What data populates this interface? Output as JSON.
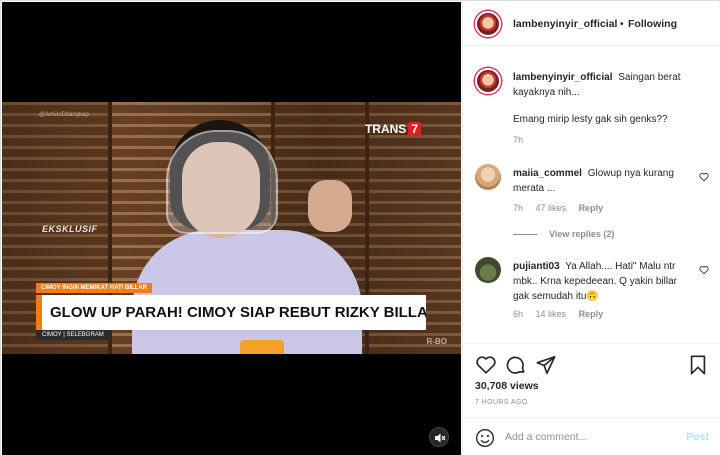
{
  "video": {
    "watermark": "@Amiin/Ditangkap",
    "channel_logo": "TRANS",
    "channel_number": "7",
    "exclusive_label": "EKSKLUSIF",
    "lower_third_kicker": "CIMOY INGIN MEMIKAT HATI BILLAR",
    "lower_third_headline": "GLOW UP PARAH! CIMOY SIAP REBUT RIZKY BILLAR DARI LESTI?",
    "lower_third_caption": "CIMOY | SELEBGRAM",
    "corner_mark": "R-BO",
    "mute_icon": "speaker-muted-icon"
  },
  "header": {
    "username": "lambenyinyir_official",
    "separator": "•",
    "follow_status": "Following"
  },
  "caption": {
    "username": "lambenyinyir_official",
    "text": "Saingan berat kayaknya nih...",
    "text2": "Emang mirip lesty gak sih genks??",
    "time": "7h"
  },
  "comments": [
    {
      "username": "maiia_commel",
      "text": "Glowup nya kurang merata ...",
      "time": "7h",
      "likes": "47 likes",
      "reply_label": "Reply",
      "view_replies": "View replies (2)"
    },
    {
      "username": "pujianti03",
      "text": "Ya Allah.... Hati\" Malu ntr mbk.. Krna kepedeean. Q yakin billar gak semudah itu🙃",
      "time": "6h",
      "likes": "14 likes",
      "reply_label": "Reply"
    }
  ],
  "actions": {
    "views": "30,708 views",
    "posted": "7 HOURS AGO"
  },
  "add_comment": {
    "placeholder": "Add a comment...",
    "post_label": "Post"
  },
  "colors": {
    "accent_blue": "#b2dffc",
    "lower_third_orange": "#f07d1a",
    "story_ring": "#e1306c"
  }
}
